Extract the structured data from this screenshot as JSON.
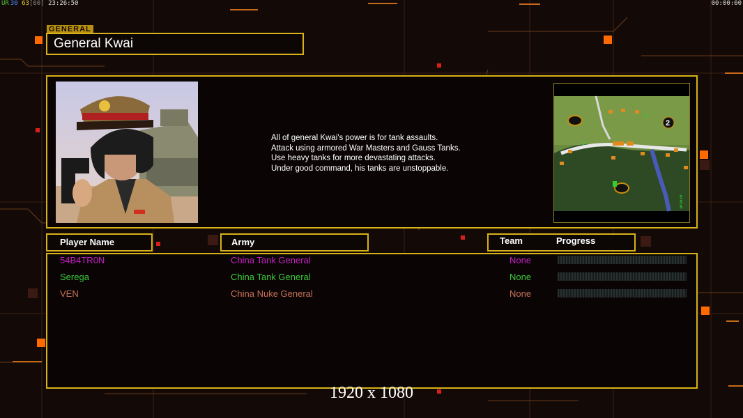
{
  "hud": {
    "ur_label": "UR",
    "ur_value": "30",
    "fps_value": "63",
    "fps_cap": "[60]",
    "clock": "23:26:50",
    "game_time": "00:00:00"
  },
  "header": {
    "tag": "GENERAL",
    "title": "General Kwai"
  },
  "general": {
    "description": [
      "All of general Kwai's power is for tank assaults.",
      "Attack using armored War Masters and Gauss Tanks.",
      "Use heavy tanks for more devastating attacks.",
      "Under good command, his tanks are unstoppable."
    ]
  },
  "minimap": {
    "start_marker": "2",
    "supply_labels": [
      "$",
      "$",
      "$",
      "$",
      "$"
    ]
  },
  "columns": {
    "player_name": "Player Name",
    "army": "Army",
    "team": "Team",
    "progress": "Progress"
  },
  "players": [
    {
      "name": "54B4TR0N",
      "army": "China Tank General",
      "team": "None",
      "color": "#c81ec8",
      "team_color": "#c81ec8",
      "progress": 0
    },
    {
      "name": "Serega",
      "army": "China Tank General",
      "team": "None",
      "color": "#3cc83c",
      "army_color": "#c81ec8",
      "team_color": "#3cc83c",
      "progress": 0
    },
    {
      "name": "VEN",
      "army": "China Nuke General",
      "team": "None",
      "color": "#c8705a",
      "army_color": "#c8705a",
      "team_color": "#c8705a",
      "progress": 0
    }
  ],
  "footer": {
    "resolution": "1920 x 1080"
  },
  "colors": {
    "frame": "#d8b218",
    "background": "#130a08",
    "accent_orange": "#ff6a00"
  }
}
